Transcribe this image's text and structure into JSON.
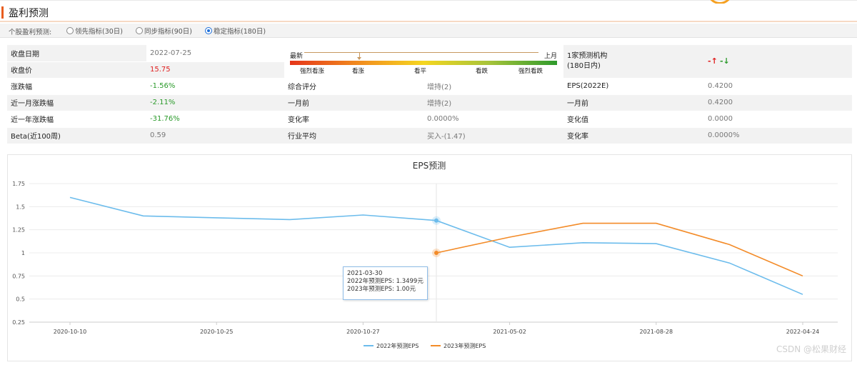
{
  "header": {
    "title": "盈利预测"
  },
  "filter": {
    "label": "个股盈利预测:",
    "options": [
      {
        "label": "领先指标(30日)",
        "selected": false
      },
      {
        "label": "同步指标(90日)",
        "selected": false
      },
      {
        "label": "稳定指标(180日)",
        "selected": true
      }
    ]
  },
  "info": {
    "close_date_label": "收盘日期",
    "close_date": "2022-07-25",
    "close_price_label": "收盘价",
    "close_price": "15.75",
    "change_label": "涨跌幅",
    "change": "-1.56%",
    "month_change_label": "近一月涨跌幅",
    "month_change": "-2.11%",
    "year_change_label": "近一年涨跌幅",
    "year_change": "-31.76%",
    "beta_label": "Beta(近100周)",
    "beta": "0.59",
    "gauge": {
      "newest": "最新",
      "last_month": "上月",
      "scale": [
        "强烈看涨",
        "看涨",
        "看平",
        "看跌",
        "强烈看跌"
      ]
    },
    "rating_label": "综合评分",
    "rating": "增持(2)",
    "month_ago_label": "一月前",
    "month_ago": "增持(2)",
    "rate_label": "变化率",
    "rate": "0.0000%",
    "industry_avg_label": "行业平均",
    "industry_avg": "买入-(1.47)",
    "inst_line1": "1家预测机构",
    "inst_line2": "(180日内)",
    "arrow_up": "-↑",
    "arrow_down": "-↓",
    "eps_label": "EPS(2022E)",
    "eps": "0.4200",
    "eps_month_ago_label": "一月前",
    "eps_month_ago": "0.4200",
    "change_value_label": "变化值",
    "change_value": "0.0000",
    "eps_rate_label": "变化率",
    "eps_rate": "0.0000%"
  },
  "tooltip": {
    "date": "2021-03-30",
    "line1": "2022年预测EPS: 1.3499元",
    "line2": "2023年预测EPS: 1.00元"
  },
  "watermark": "CSDN @松果财经",
  "colors": {
    "series_2022": "#6cbcec",
    "series_2023": "#f38b28",
    "accent": "#e85d1f"
  },
  "chart_data": {
    "type": "line",
    "title": "EPS预测",
    "xlabel": "",
    "ylabel": "",
    "ylim": [
      0.25,
      1.75
    ],
    "yticks": [
      "1.75",
      "1.5",
      "1.25",
      "1",
      "0.75",
      "0.5",
      "0.25"
    ],
    "xticks": [
      "2020-10-10",
      "2020-10-25",
      "2020-10-27",
      "2021-05-02",
      "2021-08-28",
      "2022-04-24"
    ],
    "legend": "bottom",
    "grid": true,
    "series": [
      {
        "name": "2022年预测EPS",
        "values": [
          1.6,
          1.4,
          1.38,
          1.36,
          1.41,
          1.3499,
          1.06,
          1.11,
          1.1,
          0.89,
          0.55
        ]
      },
      {
        "name": "2023年预测EPS",
        "values": [
          null,
          null,
          null,
          null,
          null,
          1.0,
          1.17,
          1.32,
          1.32,
          1.09,
          0.75
        ]
      }
    ],
    "highlight_index": 5
  }
}
